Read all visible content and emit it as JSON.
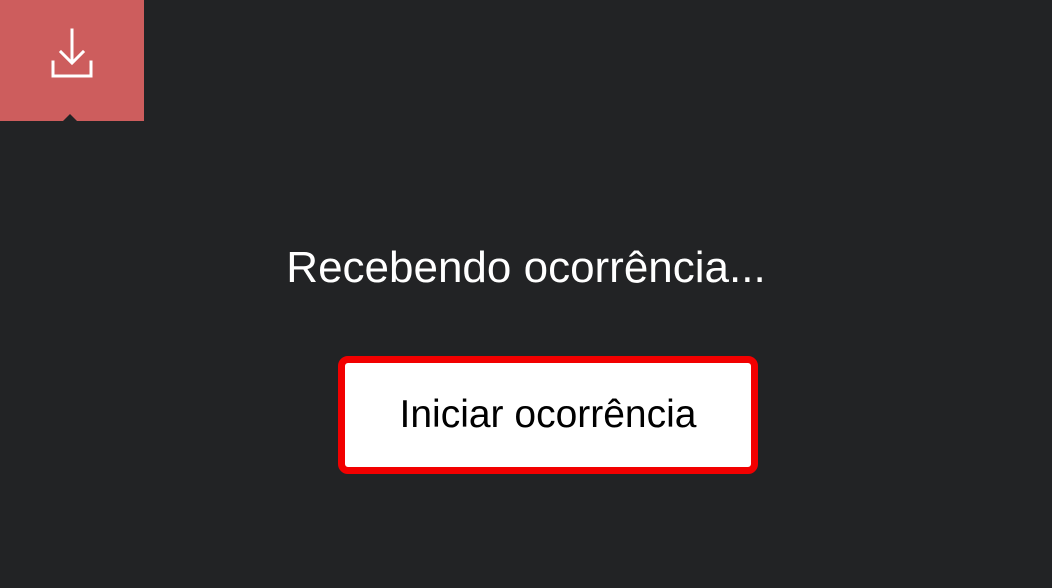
{
  "top_tab": {
    "icon": "download-icon",
    "background_color": "#cd5d5d"
  },
  "status": {
    "text": "Recebendo ocorrência..."
  },
  "actions": {
    "start_label": "Iniciar ocorrência",
    "border_color": "#f20000"
  },
  "colors": {
    "background": "#222325",
    "text": "#ffffff"
  }
}
